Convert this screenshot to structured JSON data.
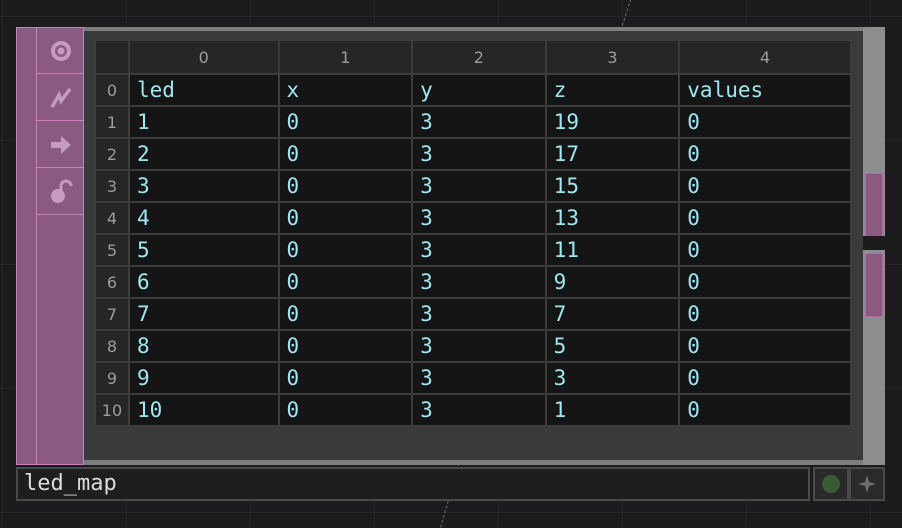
{
  "operator": {
    "name": "led_map",
    "accent_color": "#8a5a80",
    "text_color": "#9fe7f2",
    "sidebar_icons": [
      "viewer-icon",
      "bypass-icon",
      "cook-arrow-icon",
      "lock-icon"
    ]
  },
  "table": {
    "column_indices": [
      "0",
      "1",
      "2",
      "3",
      "4"
    ],
    "row_indices": [
      "0",
      "1",
      "2",
      "3",
      "4",
      "5",
      "6",
      "7",
      "8",
      "9",
      "10"
    ],
    "rows": [
      [
        "led",
        "x",
        "y",
        "z",
        "values"
      ],
      [
        "1",
        "0",
        "3",
        "19",
        "0"
      ],
      [
        "2",
        "0",
        "3",
        "17",
        "0"
      ],
      [
        "3",
        "0",
        "3",
        "15",
        "0"
      ],
      [
        "4",
        "0",
        "3",
        "13",
        "0"
      ],
      [
        "5",
        "0",
        "3",
        "11",
        "0"
      ],
      [
        "6",
        "0",
        "3",
        "9",
        "0"
      ],
      [
        "7",
        "0",
        "3",
        "7",
        "0"
      ],
      [
        "8",
        "0",
        "3",
        "5",
        "0"
      ],
      [
        "9",
        "0",
        "3",
        "3",
        "0"
      ],
      [
        "10",
        "0",
        "3",
        "1",
        "0"
      ]
    ]
  }
}
